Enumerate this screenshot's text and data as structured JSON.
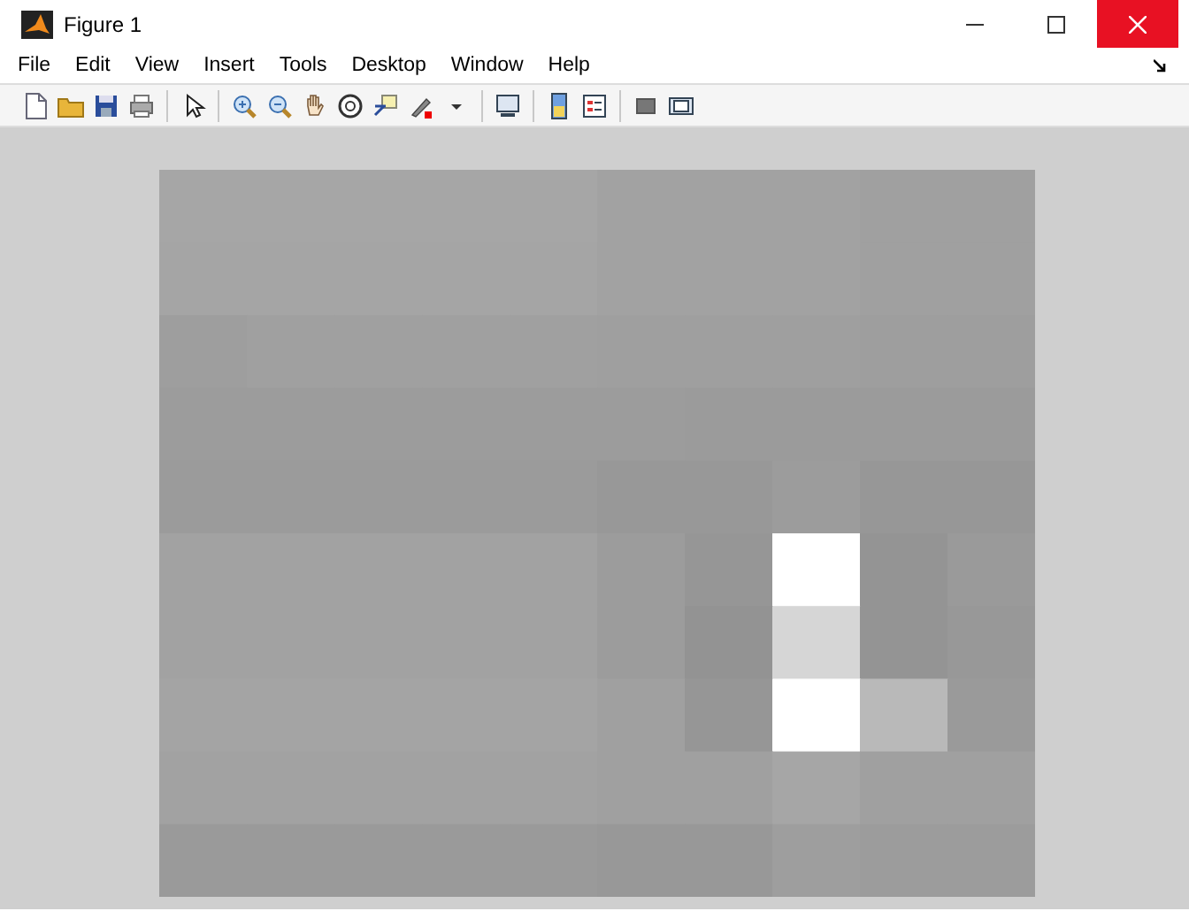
{
  "window": {
    "title": "Figure 1"
  },
  "menu": [
    "File",
    "Edit",
    "View",
    "Insert",
    "Tools",
    "Desktop",
    "Window",
    "Help"
  ]
}
